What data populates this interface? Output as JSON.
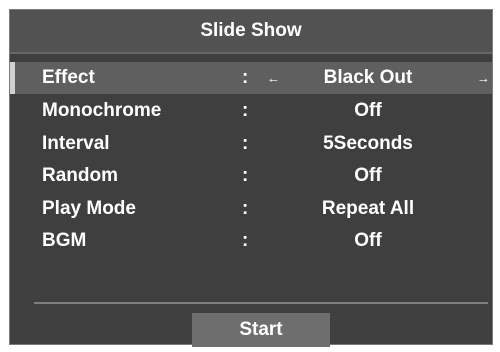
{
  "window": {
    "title": "Slide Show"
  },
  "settings": [
    {
      "label": "Effect",
      "separator": ":",
      "value": "Black Out",
      "selected": true,
      "has_arrows": true
    },
    {
      "label": "Monochrome",
      "separator": ":",
      "value": "Off"
    },
    {
      "label": "Interval",
      "separator": ":",
      "value": "5Seconds"
    },
    {
      "label": "Random",
      "separator": ":",
      "value": "Off"
    },
    {
      "label": "Play Mode",
      "separator": ":",
      "value": "Repeat All"
    },
    {
      "label": "BGM",
      "separator": ":",
      "value": "Off"
    }
  ],
  "icons": {
    "left": "arrow-left-icon",
    "right": "arrow-right-icon"
  },
  "start": {
    "label": "Start"
  },
  "colors": {
    "panel_bg": "#3f3f3f",
    "title_bg": "#525252",
    "selected_row_bg": "#5f5f5f",
    "button_bg": "#6e6e6e",
    "text": "#ffffff"
  }
}
